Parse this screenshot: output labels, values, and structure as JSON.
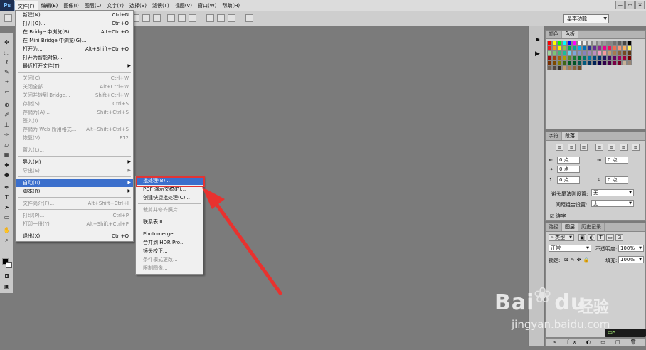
{
  "app": {
    "logo": "Ps"
  },
  "menubar": {
    "items": [
      "文件(F)",
      "编辑(E)",
      "图像(I)",
      "图层(L)",
      "文字(Y)",
      "选择(S)",
      "滤镜(T)",
      "视图(V)",
      "窗口(W)",
      "帮助(H)"
    ],
    "window_controls": [
      "—",
      "▭",
      "✕"
    ]
  },
  "workspace": {
    "value": "基本功能"
  },
  "file_menu": {
    "items": [
      {
        "label": "新建(N)...",
        "shortcut": "Ctrl+N",
        "disabled": false
      },
      {
        "label": "打开(O)...",
        "shortcut": "Ctrl+O",
        "disabled": false
      },
      {
        "label": "在 Bridge 中浏览(B)...",
        "shortcut": "Alt+Ctrl+O",
        "disabled": false
      },
      {
        "label": "在 Mini Bridge 中浏览(G)...",
        "shortcut": "",
        "disabled": false
      },
      {
        "label": "打开为...",
        "shortcut": "Alt+Shift+Ctrl+O",
        "disabled": false
      },
      {
        "label": "打开为智能对象...",
        "shortcut": "",
        "disabled": false
      },
      {
        "label": "最近打开文件(T)",
        "shortcut": "",
        "disabled": false,
        "submenu": true
      },
      {
        "sep": true
      },
      {
        "label": "关闭(C)",
        "shortcut": "Ctrl+W",
        "disabled": true
      },
      {
        "label": "关闭全部",
        "shortcut": "Alt+Ctrl+W",
        "disabled": true
      },
      {
        "label": "关闭并转到 Bridge...",
        "shortcut": "Shift+Ctrl+W",
        "disabled": true
      },
      {
        "label": "存储(S)",
        "shortcut": "Ctrl+S",
        "disabled": true
      },
      {
        "label": "存储为(A)...",
        "shortcut": "Shift+Ctrl+S",
        "disabled": true
      },
      {
        "label": "签入(I)...",
        "shortcut": "",
        "disabled": true
      },
      {
        "label": "存储为 Web 所用格式...",
        "shortcut": "Alt+Shift+Ctrl+S",
        "disabled": true
      },
      {
        "label": "恢复(V)",
        "shortcut": "F12",
        "disabled": true
      },
      {
        "sep": true
      },
      {
        "label": "置入(L)...",
        "shortcut": "",
        "disabled": true
      },
      {
        "sep": true
      },
      {
        "label": "导入(M)",
        "shortcut": "",
        "disabled": false,
        "submenu": true
      },
      {
        "label": "导出(E)",
        "shortcut": "",
        "disabled": true,
        "submenu": true
      },
      {
        "sep": true
      },
      {
        "label": "自动(U)",
        "shortcut": "",
        "disabled": false,
        "submenu": true,
        "highlighted": true
      },
      {
        "label": "脚本(R)",
        "shortcut": "",
        "disabled": false,
        "submenu": true
      },
      {
        "sep": true
      },
      {
        "label": "文件简介(F)...",
        "shortcut": "Alt+Shift+Ctrl+I",
        "disabled": true
      },
      {
        "sep": true
      },
      {
        "label": "打印(P)...",
        "shortcut": "Ctrl+P",
        "disabled": true
      },
      {
        "label": "打印一份(Y)",
        "shortcut": "Alt+Shift+Ctrl+P",
        "disabled": true
      },
      {
        "sep": true
      },
      {
        "label": "退出(X)",
        "shortcut": "Ctrl+Q",
        "disabled": false
      }
    ]
  },
  "auto_submenu": {
    "items": [
      {
        "label": "批处理(B)...",
        "disabled": false,
        "highlighted": true
      },
      {
        "label": "PDF 演示文稿(P)...",
        "disabled": false
      },
      {
        "label": "创建快捷批处理(C)...",
        "disabled": false
      },
      {
        "sep": true
      },
      {
        "label": "裁剪并修齐照片",
        "disabled": true
      },
      {
        "sep": true
      },
      {
        "label": "联系表 II...",
        "disabled": false
      },
      {
        "sep": true
      },
      {
        "label": "Photomerge...",
        "disabled": false
      },
      {
        "label": "合并到 HDR Pro...",
        "disabled": false
      },
      {
        "label": "镜头校正...",
        "disabled": false
      },
      {
        "label": "条件模式更改...",
        "disabled": true
      },
      {
        "label": "限制图像...",
        "disabled": true
      }
    ]
  },
  "color_panel": {
    "tabs": [
      "颜色",
      "色板"
    ],
    "swatches": [
      "#ff0000",
      "#ffff00",
      "#00ff00",
      "#00ffff",
      "#0000ff",
      "#ff00ff",
      "#ffffff",
      "#ebebeb",
      "#d6d6d6",
      "#c2c2c2",
      "#adadad",
      "#999999",
      "#858585",
      "#707070",
      "#5c5c5c",
      "#474747",
      "#000000",
      "#ed1c24",
      "#f7941d",
      "#fff200",
      "#8dc63f",
      "#00a651",
      "#00a99d",
      "#00aeef",
      "#0072bc",
      "#2e3192",
      "#662d91",
      "#92278f",
      "#ec008c",
      "#ed145b",
      "#f26c4f",
      "#f69679",
      "#fbaf5d",
      "#fff568",
      "#a3d39c",
      "#7cc576",
      "#3cb878",
      "#1abc9c",
      "#6dcff6",
      "#7da7d9",
      "#8393ca",
      "#8781bd",
      "#a186be",
      "#bd8cbf",
      "#f49ac1",
      "#f5989d",
      "#c69c6d",
      "#a67c52",
      "#8c6239",
      "#754c24",
      "#603913",
      "#9e0b0f",
      "#a0410d",
      "#a3620a",
      "#aba000",
      "#598527",
      "#197b30",
      "#007236",
      "#00746b",
      "#0076a3",
      "#004a80",
      "#003471",
      "#1b1464",
      "#440e62",
      "#630460",
      "#9e005d",
      "#9e0039",
      "#790000",
      "#7b2e00",
      "#7d4900",
      "#827b00",
      "#406618",
      "#005e20",
      "#005826",
      "#005952",
      "#005b7f",
      "#003663",
      "#002157",
      "#0d004c",
      "#32004b",
      "#4b0049",
      "#7b0046",
      "#7a0026",
      "#c7b299",
      "#998675",
      "#736357",
      "#534741",
      "#37302a",
      "#c69c6d",
      "#a67c52",
      "#8c6239",
      "#754c24"
    ]
  },
  "para_panel": {
    "tabs": [
      "字符",
      "段落"
    ],
    "fields": [
      "0 点",
      "0 点",
      "0 点",
      "0 点",
      "0 点"
    ],
    "kinsoku_label": "避头尾法则设置:",
    "kinsoku_value": "无",
    "mojikumi_label": "间距组合设置:",
    "mojikumi_value": "无",
    "hyphen_label": "连字"
  },
  "layers_panel": {
    "tabs": [
      "路径",
      "图层",
      "历史记录"
    ],
    "kind_label": "类型",
    "blend_mode": "正常",
    "opacity_label": "不透明度:",
    "opacity_value": "100%",
    "lock_label": "锁定:",
    "fill_label": "填充:",
    "fill_value": "100%"
  },
  "watermark": {
    "logo": "Bai",
    "logo_paw": "du",
    "jingyan": "经验",
    "url": "jingyan.baidu.com"
  },
  "corner_badge": {
    "text": "中5"
  }
}
